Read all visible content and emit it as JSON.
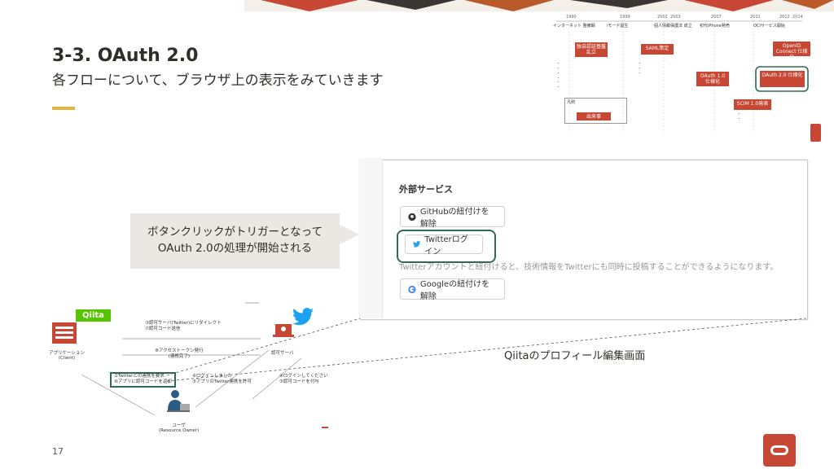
{
  "slide": {
    "title": "3-3. OAuth 2.0",
    "subtitle": "各フローについて、ブラウザ上の表示をみていきます",
    "page_number": "17"
  },
  "timeline": {
    "years": [
      "1990",
      "1999",
      "2002",
      "2003",
      "2007",
      "2011",
      "2012",
      "2014"
    ],
    "events": [
      "インターネット 整備期",
      "iモード誕生",
      "個人情報保護法 成立",
      "初代iPhone発売",
      "OCIサービス開始"
    ],
    "boxes": [
      "独自認証基盤 乱立",
      "SAML策定",
      "OAuth 1.0 仕様化",
      "OAuth 2.0 仕様化",
      "SCIM 1.0発表",
      "OpenID Connect 仕様化",
      "出来事"
    ],
    "legend_label": "凡例"
  },
  "callout": {
    "line1": "ボタンクリックがトリガーとなって",
    "line2": "OAuth 2.0の処理が開始される"
  },
  "profile_panel": {
    "section_title": "外部サービス",
    "github_button": "GitHubの紐付けを解除",
    "twitter_button": "Twitterログイン",
    "note": "Twitterアカウントと紐付けると、技術情報をTwitterにも同時に投稿することができるようになります。",
    "google_button": "Googleの紐付けを解除",
    "caption": "Qiitaのプロフィール編集画面"
  },
  "diagram": {
    "qiita_logo": "Qiita",
    "client_label_1": "アプリケーション",
    "client_label_2": "(Client)",
    "auth_server_label": "認可サーバ",
    "owner_label_1": "ユーザ",
    "owner_label_2": "(Resource Owner)",
    "step_redirect": "③認可サーバ(Twitter)にリダイレクト",
    "step_code": "⑦認可コード送信",
    "step_token_1": "⑧アクセストークン発行",
    "step_token_2": "(連携完了)",
    "step_user_1": "②Twitterとの連携を要求",
    "step_user_2": "⑥アプリに認可コードを返却",
    "step_login_1": "④ログインしました",
    "step_login_2": "⑤アプリのTwitter連携を許可",
    "step_login_req_1": "④ログインしてください",
    "step_login_req_2": "⑤認可コードを付与"
  },
  "colors": {
    "oracle_red": "#c74634",
    "accent_yellow": "#e5b440",
    "highlight_green": "#2e6b52",
    "qiita_green": "#55c500",
    "twitter_blue": "#1da1f2"
  }
}
